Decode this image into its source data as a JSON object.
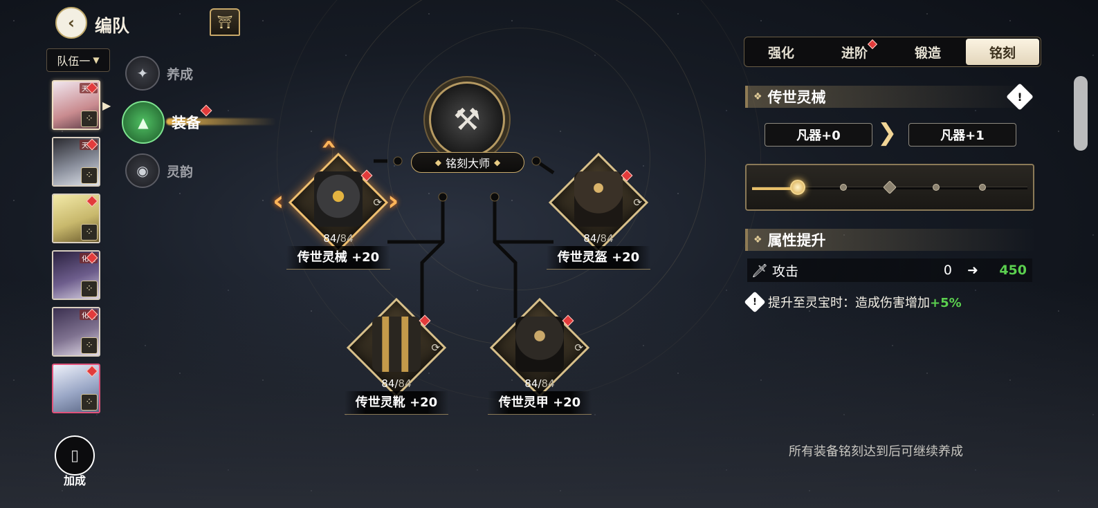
{
  "header": {
    "back_icon": "back-arrow-icon",
    "title": "编队",
    "shrine_icon": "shrine-icon"
  },
  "team_select": {
    "value": "队伍一"
  },
  "roster": [
    {
      "tag": "天穹",
      "selected": true,
      "color": "#c98b8f"
    },
    {
      "tag": "天穹",
      "selected": false,
      "color": "#8a8f9c"
    },
    {
      "tag": "",
      "selected": false,
      "color": "#c8b86c"
    },
    {
      "tag": "化境",
      "selected": false,
      "color": "#6d5d8c"
    },
    {
      "tag": "化境",
      "selected": false,
      "color": "#7f7290"
    },
    {
      "tag": "",
      "selected": false,
      "color": "#9aa7c6"
    }
  ],
  "nav": {
    "cultivate": "养成",
    "equipment": "装备",
    "charm": "灵韵"
  },
  "bonus": {
    "label": "加成"
  },
  "master": {
    "label": "铭刻大师"
  },
  "equipment": [
    {
      "name": "传世灵械 +20",
      "level": "84",
      "max": "84"
    },
    {
      "name": "传世灵盔 +20",
      "level": "84",
      "max": "84"
    },
    {
      "name": "传世灵靴 +20",
      "level": "84",
      "max": "84"
    },
    {
      "name": "传世灵甲 +20",
      "level": "84",
      "max": "84"
    }
  ],
  "tabs": [
    {
      "label": "强化",
      "active": false,
      "dot": false
    },
    {
      "label": "进阶",
      "active": false,
      "dot": true
    },
    {
      "label": "锻造",
      "active": false,
      "dot": false
    },
    {
      "label": "铭刻",
      "active": true,
      "dot": false
    }
  ],
  "panel": {
    "item_title": "传世灵械",
    "grade_from": "凡器+0",
    "grade_to": "凡器+1",
    "progress": {
      "nodes": 5,
      "current": 1,
      "fill_fraction": 0.17
    },
    "attr_title": "属性提升",
    "stat": {
      "name": "攻击",
      "from": "0",
      "to": "450"
    },
    "tip_text": "提升至灵宝时：造成伤害增加",
    "tip_bonus": "+5%",
    "footnote": "所有装备铭刻达到后可继续养成"
  },
  "colors": {
    "accent_gold": "#d8c08a",
    "stat_green": "#5bd04f",
    "red_dot": "#e23b3b",
    "active_nav": "#4fbf62"
  }
}
